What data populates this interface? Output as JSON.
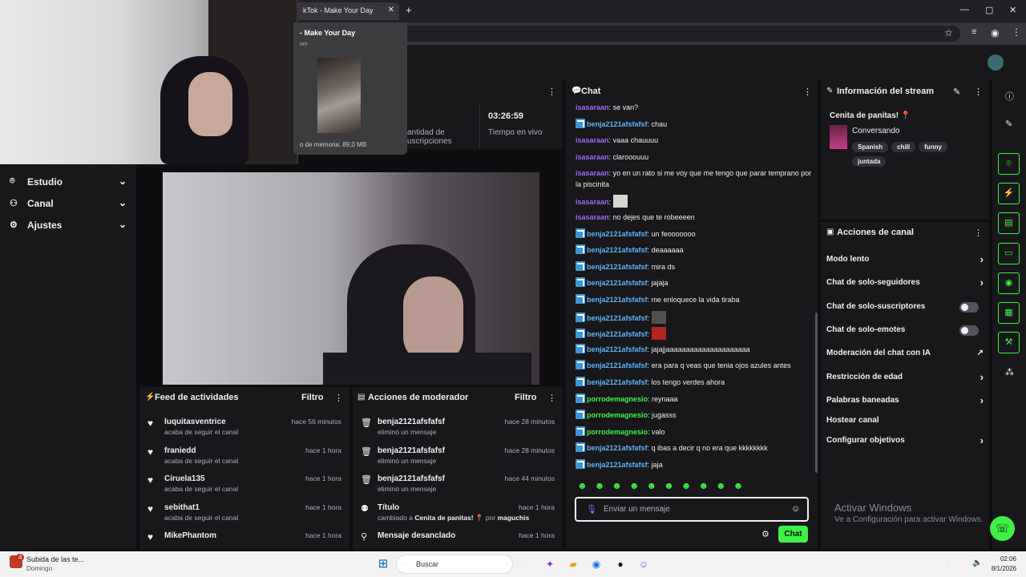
{
  "browser": {
    "tab_title": "TikTok - Make Your Day",
    "tab_title_visible": "kTok - Make Your Day",
    "preview_title": "- Make Your Day",
    "preview_url_fragment": "om",
    "preview_memory": "o de memoria: 89,0 MB"
  },
  "nav": {
    "items": [
      {
        "label": "Estudio",
        "icon": "camera-icon"
      },
      {
        "label": "Canal",
        "icon": "users-icon"
      },
      {
        "label": "Ajustes",
        "icon": "gear-icon"
      }
    ]
  },
  "stats": {
    "subs_label_1": "antidad de",
    "subs_label_2": "uscripciones",
    "live_time_value": "03:26:59",
    "live_time_label": "Tiempo en vivo"
  },
  "activity_feed": {
    "title": "Feed de actividades",
    "filter": "Filtro",
    "items": [
      {
        "name": "luquitasventrice",
        "sub": "acaba de seguir el canal",
        "time": "hace 56 minutos"
      },
      {
        "name": "franiedd",
        "sub": "acaba de seguir el canal",
        "time": "hace 1 hora"
      },
      {
        "name": "Ciruela135",
        "sub": "acaba de seguir el canal",
        "time": "hace 1 hora"
      },
      {
        "name": "sebithat1",
        "sub": "acaba de seguir el canal",
        "time": "hace 1 hora"
      },
      {
        "name": "MikePhantom",
        "sub": "",
        "time": "hace 1 hora"
      }
    ]
  },
  "mod_actions": {
    "title": "Acciones de moderador",
    "filter": "Filtro",
    "items": [
      {
        "name": "benja2121afsfafsf",
        "sub": "eliminó un mensaje",
        "time": "hace 28 minutos",
        "icon": "trash-icon"
      },
      {
        "name": "benja2121afsfafsf",
        "sub": "eliminó un mensaje",
        "time": "hace 28 minutos",
        "icon": "trash-icon"
      },
      {
        "name": "benja2121afsfafsf",
        "sub": "eliminó un mensaje",
        "time": "hace 44 minutos",
        "icon": "trash-icon"
      },
      {
        "name": "Título",
        "sub_prefix": "cambiado a",
        "sub_value": "Cenita de panitas! 📍",
        "sub_by": "por",
        "sub_user": "maguchis",
        "time": "hace 1 hora",
        "icon": "user-edit-icon"
      },
      {
        "name": "Mensaje desanclado",
        "sub": "",
        "time": "hace 1 hora",
        "icon": "unpin-icon"
      }
    ]
  },
  "chat": {
    "title": "Chat",
    "messages": [
      {
        "user": "isasaraan",
        "color": "purple",
        "badge": false,
        "text": "se van?"
      },
      {
        "user": "benja2121afsfafsf",
        "color": "blue",
        "badge": true,
        "text": "chau"
      },
      {
        "user": "isasaraan",
        "color": "purple",
        "badge": false,
        "text": "vaaa chauuuu"
      },
      {
        "user": "isasaraan",
        "color": "purple",
        "badge": false,
        "text": "clarooouuu"
      },
      {
        "user": "isasaraan",
        "color": "purple",
        "badge": false,
        "text": "yo en un rato si me voy que me tengo que parar temprano por la piscinita"
      },
      {
        "user": "isasaraan",
        "color": "purple",
        "badge": false,
        "text": "",
        "emote": "cat-emote"
      },
      {
        "user": "isasaraan",
        "color": "purple",
        "badge": false,
        "text": "no dejes que te robeeeen"
      },
      {
        "user": "benja2121afsfafsf",
        "color": "blue",
        "badge": true,
        "text": "un feooooooo"
      },
      {
        "user": "benja2121afsfafsf",
        "color": "blue",
        "badge": true,
        "text": "deaaaaaa"
      },
      {
        "user": "benja2121afsfafsf",
        "color": "blue",
        "badge": true,
        "text": "mira ds"
      },
      {
        "user": "benja2121afsfafsf",
        "color": "blue",
        "badge": true,
        "text": "jajaja"
      },
      {
        "user": "benja2121afsfafsf",
        "color": "blue",
        "badge": true,
        "text": "me enloquece la vida tiraba"
      },
      {
        "user": "benja2121afsfafsf",
        "color": "blue",
        "badge": true,
        "text": "",
        "emote": "face-emote"
      },
      {
        "user": "benja2121afsfafsf",
        "color": "blue",
        "badge": true,
        "text": "",
        "emote": "red-face-emote"
      },
      {
        "user": "benja2121afsfafsf",
        "color": "blue",
        "badge": true,
        "text": "jajajjaaaaaaaaaaaaaaaaaaaaa"
      },
      {
        "user": "benja2121afsfafsf",
        "color": "blue",
        "badge": true,
        "text": "era para q veas que tenia ojos azules antes"
      },
      {
        "user": "benja2121afsfafsf",
        "color": "blue",
        "badge": true,
        "text": "los tengo verdes ahora"
      },
      {
        "user": "porrodemagnesio",
        "color": "green",
        "badge": true,
        "text": "reynaaa"
      },
      {
        "user": "porrodemagnesio",
        "color": "green",
        "badge": true,
        "text": "jugasss"
      },
      {
        "user": "porrodemagnesio",
        "color": "green",
        "badge": true,
        "text": "valo"
      },
      {
        "user": "benja2121afsfafsf",
        "color": "blue",
        "badge": true,
        "text": "q ibas a decir q no era que kkkkkkkk"
      },
      {
        "user": "benja2121afsfafsf",
        "color": "blue",
        "badge": true,
        "text": "jaja"
      }
    ],
    "input_placeholder": "Enviar un mensaje",
    "send_label": "Chat"
  },
  "stream_info": {
    "title": "Información del stream",
    "stream_title": "Cenita de panitas! 📍",
    "category": "Conversando",
    "tags": [
      "Spanish",
      "chill",
      "funny",
      "juntada"
    ]
  },
  "channel_actions": {
    "title": "Acciones de canal",
    "items": [
      {
        "label": "Modo lento",
        "control": "chevron"
      },
      {
        "label": "Chat de solo-seguidores",
        "control": "chevron"
      },
      {
        "label": "Chat de solo-suscriptores",
        "control": "toggle",
        "on": false
      },
      {
        "label": "Chat de solo-emotes",
        "control": "toggle",
        "on": false
      },
      {
        "label": "Moderación del chat con IA",
        "control": "external"
      },
      {
        "label": "Restricción de edad",
        "control": "chevron"
      },
      {
        "label": "Palabras baneadas",
        "control": "chevron"
      },
      {
        "label": "Hostear canal",
        "control": "none"
      },
      {
        "label": "Configurar objetivos",
        "control": "chevron"
      }
    ]
  },
  "windows_watermark": {
    "line1": "Activar Windows",
    "line2": "Ve a Configuración para activar Windows."
  },
  "taskbar": {
    "notif_count": "4",
    "notif_title": "Subida de las te...",
    "notif_sub": "Domingo",
    "search_placeholder": "Buscar",
    "time": "02:06",
    "date": "8/1/2026"
  },
  "colors": {
    "accent": "#3ff046",
    "panel": "#18181b",
    "bg": "#0e0e10",
    "user_purple": "#9a6bf5",
    "user_blue": "#5fb4f5"
  }
}
